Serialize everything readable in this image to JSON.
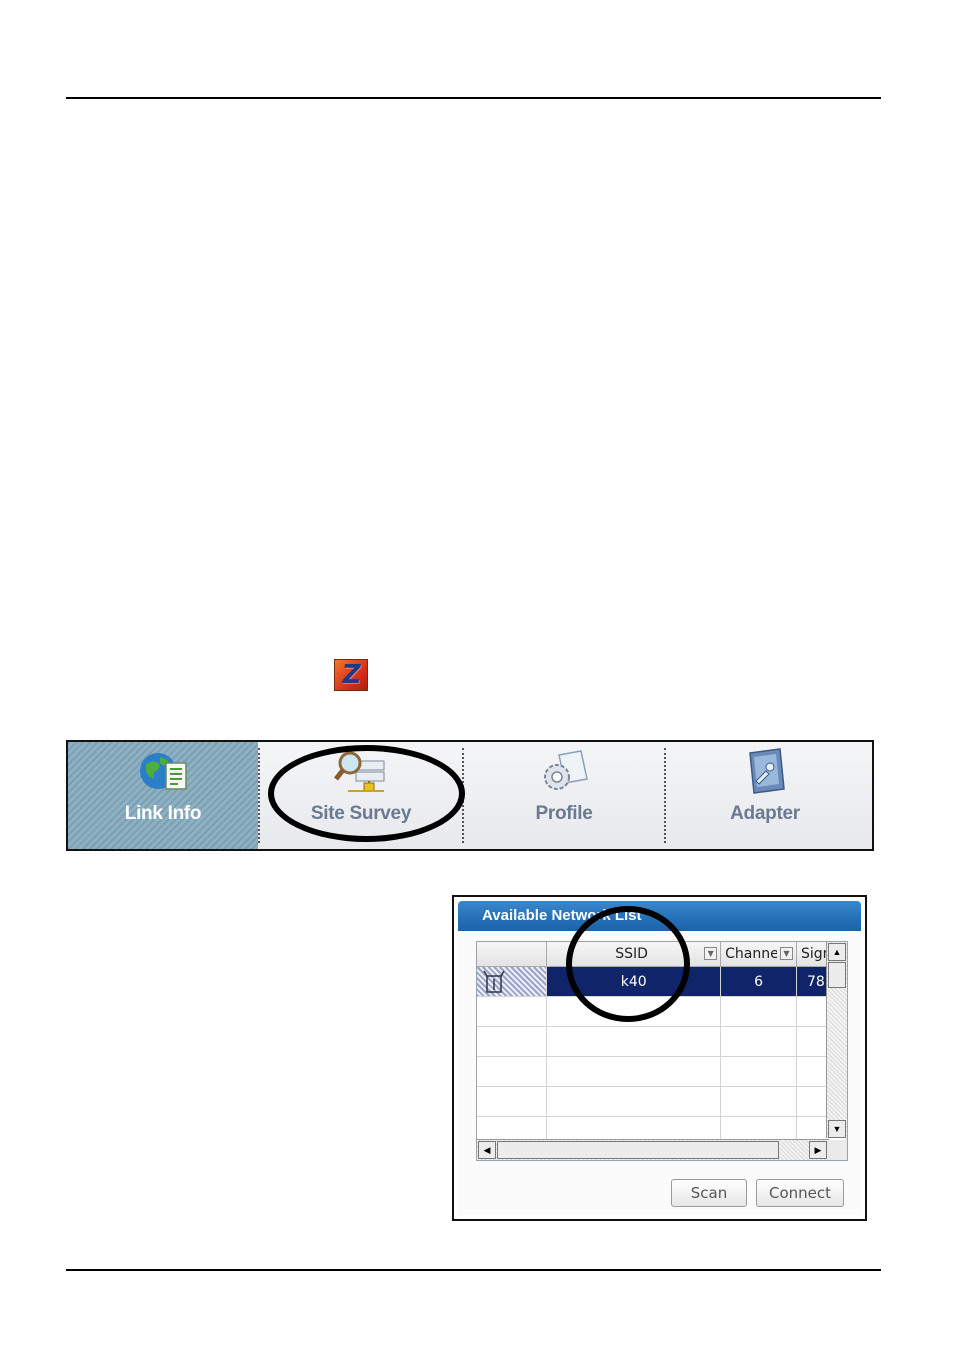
{
  "app_icon": {
    "letter": "Z",
    "name": "zyxel-utility-icon"
  },
  "toolbar": {
    "items": [
      {
        "label": "Link Info",
        "icon": "globe-document-icon",
        "active": true
      },
      {
        "label": "Site Survey",
        "icon": "magnifier-network-icon",
        "active": false
      },
      {
        "label": "Profile",
        "icon": "gear-document-icon",
        "active": false
      },
      {
        "label": "Adapter",
        "icon": "adapter-icon",
        "active": false
      }
    ]
  },
  "network_list": {
    "title": "Available Network List",
    "columns": [
      "",
      "SSID",
      "Channel",
      "Signal"
    ],
    "rows": [
      {
        "icon": "access-point-icon",
        "ssid": "k40",
        "channel": "6",
        "signal": "78",
        "selected": true
      }
    ],
    "empty_rows": 5,
    "buttons": {
      "scan": "Scan",
      "connect": "Connect"
    }
  }
}
